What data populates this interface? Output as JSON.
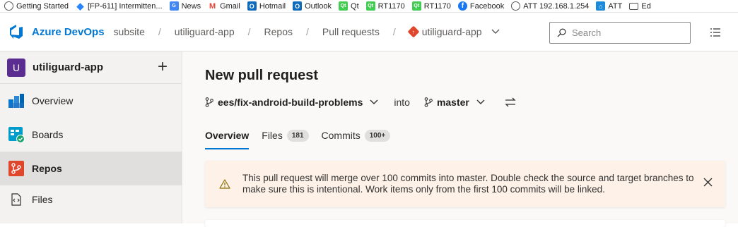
{
  "bookmarks": [
    {
      "label": "Getting Started",
      "icon": "globe-icon"
    },
    {
      "label": "[FP-611] Intermitten...",
      "icon": "jira-icon"
    },
    {
      "label": "News",
      "icon": "google-news-icon"
    },
    {
      "label": "Gmail",
      "icon": "gmail-icon"
    },
    {
      "label": "Hotmail",
      "icon": "outlook-icon"
    },
    {
      "label": "Outlook",
      "icon": "outlook-icon"
    },
    {
      "label": "Qt",
      "icon": "qt-icon"
    },
    {
      "label": "RT1170",
      "icon": "qt-icon"
    },
    {
      "label": "RT1170",
      "icon": "qt-icon"
    },
    {
      "label": "Facebook",
      "icon": "facebook-icon"
    },
    {
      "label": "ATT 192.168.1.254",
      "icon": "globe-icon"
    },
    {
      "label": "ATT",
      "icon": "att-icon"
    },
    {
      "label": "Ed",
      "icon": "folder-icon"
    }
  ],
  "header": {
    "product": "Azure DevOps",
    "breadcrumbs": [
      "subsite",
      "utiliguard-app",
      "Repos",
      "Pull requests"
    ],
    "repo_crumb": "utiliguard-app",
    "search_placeholder": "Search"
  },
  "sidebar": {
    "project_initial": "U",
    "project_name": "utiliguard-app",
    "items": [
      {
        "label": "Overview",
        "icon": "overview-icon"
      },
      {
        "label": "Boards",
        "icon": "boards-icon"
      },
      {
        "label": "Repos",
        "icon": "repos-icon",
        "active": true
      },
      {
        "label": "Files",
        "icon": "files-icon"
      }
    ]
  },
  "main": {
    "title": "New pull request",
    "source_branch": "ees/fix-android-build-problems",
    "into_label": "into",
    "target_branch": "master",
    "tabs": [
      {
        "label": "Overview",
        "active": true
      },
      {
        "label": "Files",
        "count": "181"
      },
      {
        "label": "Commits",
        "count": "100+"
      }
    ],
    "warning": "This pull request will merge over 100 commits into master. Double check the source and target branches to make sure this is intentional. Work items only from the first 100 commits will be linked."
  },
  "colors": {
    "accent": "#0078d4",
    "warning_bg": "#fdf1e8",
    "project_avatar": "#5c2d91",
    "repos_icon": "#e0462c"
  }
}
